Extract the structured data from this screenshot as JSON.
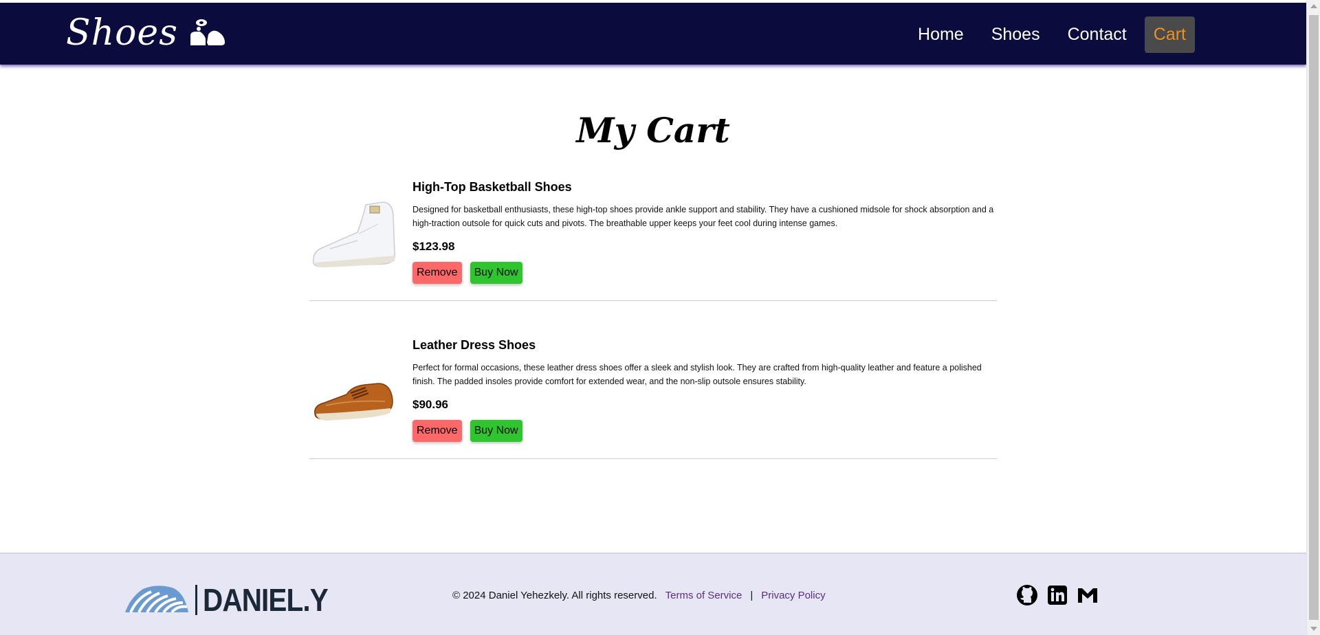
{
  "header": {
    "logo_text": "Shoes",
    "nav": [
      {
        "label": "Home",
        "active": false
      },
      {
        "label": "Shoes",
        "active": false
      },
      {
        "label": "Contact",
        "active": false
      },
      {
        "label": "Cart",
        "active": true
      }
    ]
  },
  "main": {
    "title": "My Cart",
    "items": [
      {
        "name": "High-Top Basketball Shoes",
        "description": "Designed for basketball enthusiasts, these high-top shoes provide ankle support and stability. They have a cushioned midsole for shock absorption and a high-traction outsole for quick cuts and pivots. The breathable upper keeps your feet cool during intense games.",
        "price": "$123.98",
        "remove_label": "Remove",
        "buy_label": "Buy Now"
      },
      {
        "name": "Leather Dress Shoes",
        "description": "Perfect for formal occasions, these leather dress shoes offer a sleek and stylish look. They are crafted from high-quality leather and feature a polished finish. The padded insoles provide comfort for extended wear, and the non-slip outsole ensures stability.",
        "price": "$90.96",
        "remove_label": "Remove",
        "buy_label": "Buy Now"
      }
    ]
  },
  "footer": {
    "brand": "DANIEL.Y",
    "copyright": "© 2024 Daniel Yehezkely. All rights reserved.",
    "terms": "Terms of Service",
    "separator": "|",
    "privacy": "Privacy Policy",
    "social_icons": [
      "github-icon",
      "linkedin-icon",
      "gmail-icon"
    ]
  },
  "colors": {
    "header_bg": "#0b0c3d",
    "active_nav_bg": "#4a4a4a",
    "active_nav_text": "#f0901a",
    "remove_btn": "#ff6868",
    "buy_btn": "#2fc52f",
    "footer_bg": "#e6e6f5",
    "footer_link": "#5a2d8a"
  }
}
